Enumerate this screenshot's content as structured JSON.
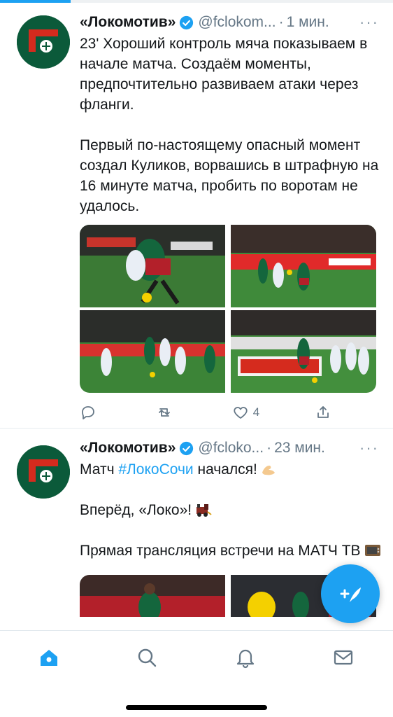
{
  "progress": {
    "value": 0.18
  },
  "tweets": [
    {
      "name": "«Локомотив»",
      "handle": "@fclokom...",
      "separator": "·",
      "time": "1 мин.",
      "more": "···",
      "paragraphs": [
        "23' Хороший контроль мяча показываем в начале матча. Создаём моменты, предпочтительно развиваем атаки через фланги.",
        "Первый по-настоящему опасный момент создал Куликов, ворвашись в штрафную на 16 минуте матча, пробить по воротам не удалось."
      ],
      "photos": 4,
      "reply_count": "",
      "retweet_count": "",
      "like_count": "4"
    },
    {
      "name": "«Локомотив»",
      "handle": "@fcloko...",
      "separator": "·",
      "time": "23 мин.",
      "more": "···",
      "line1_before": "Матч ",
      "hashtag": "#ЛокоСочи",
      "line1_after": " начался!",
      "line2": "Вперёд, «Локо»!",
      "line3": "Прямая трансляция встречи на МАТЧ ТВ",
      "photos": 2
    }
  ],
  "icons": {
    "verified": "verified-badge-icon",
    "reply": "reply-icon",
    "retweet": "retweet-icon",
    "like": "heart-icon",
    "share": "share-icon",
    "compose": "compose-tweet-icon",
    "home": "home-icon",
    "search": "search-icon",
    "notifications": "bell-icon",
    "messages": "mail-icon"
  },
  "colors": {
    "accent": "#1da1f2",
    "text": "#14171a",
    "secondary": "#657786",
    "club_green": "#0b5a3a",
    "club_red": "#d52b1e"
  }
}
